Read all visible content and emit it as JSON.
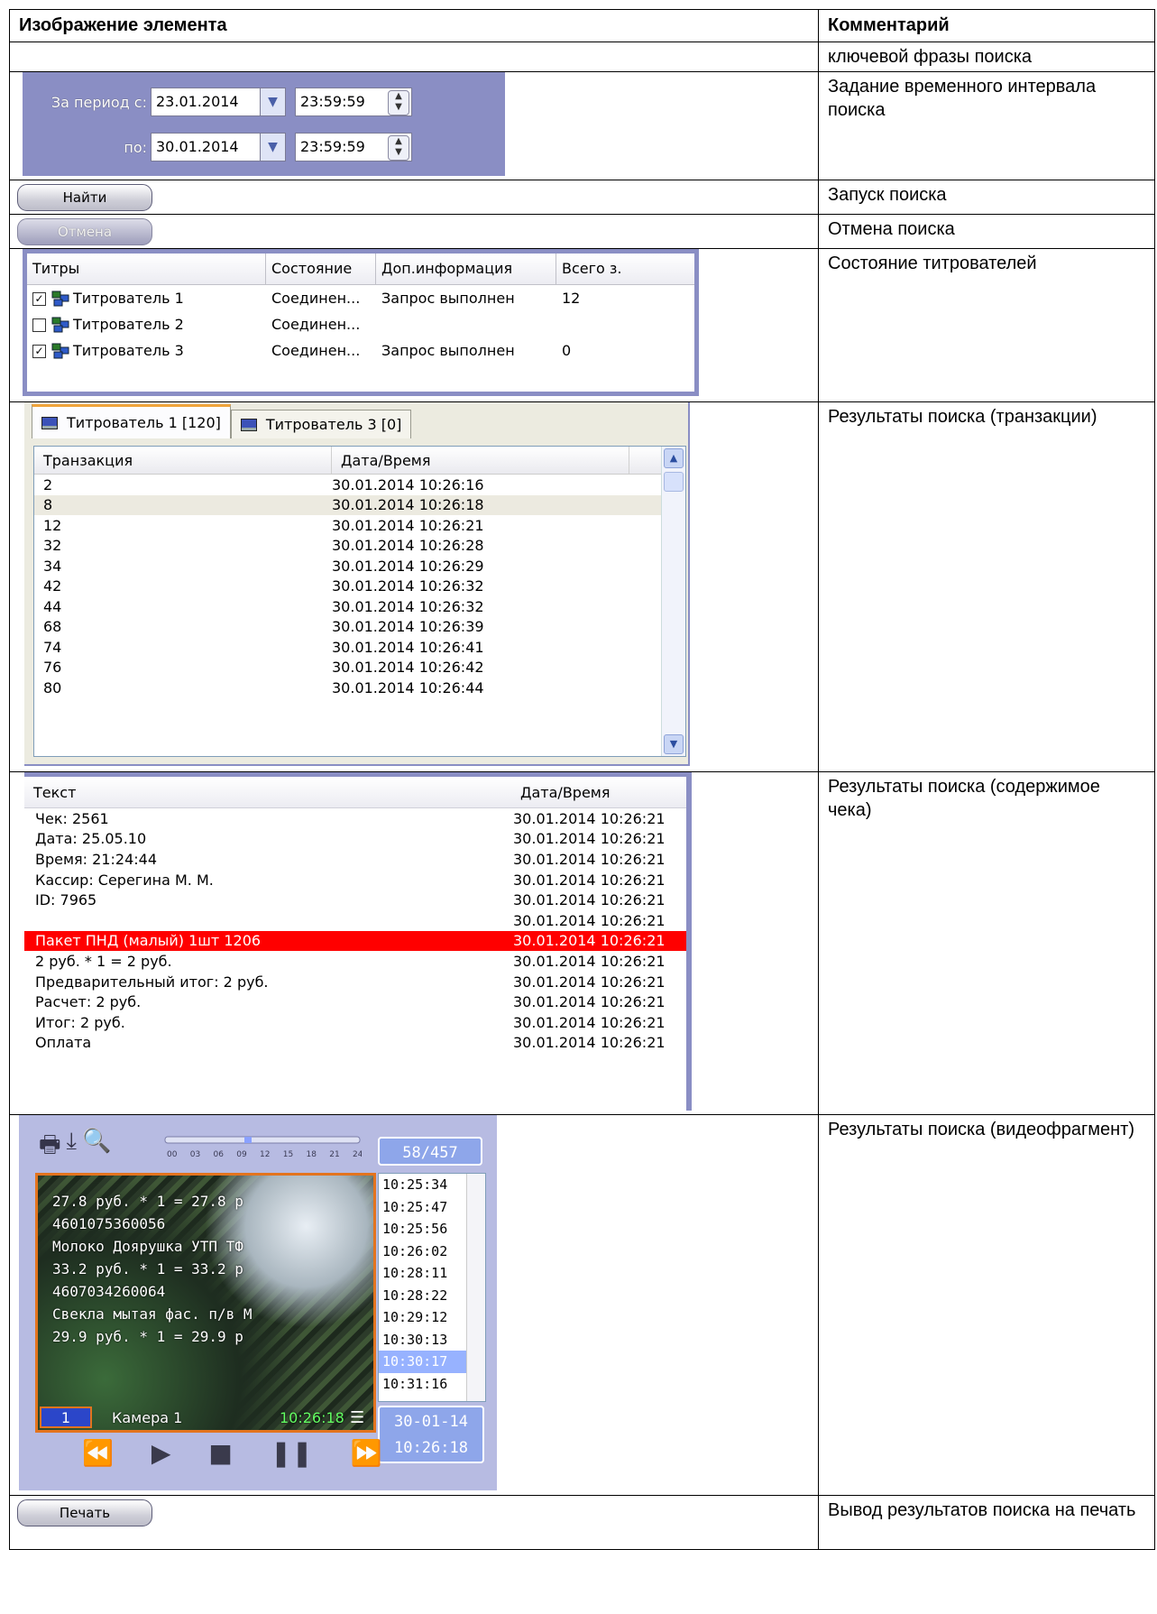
{
  "table": {
    "header_left": "Изображение элемента",
    "header_right": "Комментарий"
  },
  "rows": {
    "r0_comment": "ключевой фразы поиска",
    "r1_comment": "Задание временного интервала поиска",
    "r2_comment": "Запуск поиска",
    "r3_comment": "Отмена поиска",
    "r4_comment": "Состояние титрователей",
    "r5_comment": "Результаты поиска (транзакции)",
    "r6_comment": "Результаты поиска (содержимое чека)",
    "r7_comment": "Результаты поиска (видеофрагмент)",
    "r8_comment": "Вывод результатов поиска на печать"
  },
  "period": {
    "from_label": "За период с:",
    "to_label": "по:",
    "from_date": "23.01.2014",
    "from_time": "23:59:59",
    "to_date": "30.01.2014",
    "to_time": "23:59:59"
  },
  "buttons": {
    "find": "Найти",
    "cancel": "Отмена",
    "print": "Печать"
  },
  "state_table": {
    "headers": [
      "Титры",
      "Состояние",
      "Доп.информация",
      "Всего з."
    ],
    "rows": [
      {
        "checked": true,
        "name": "Титрователь 1",
        "state": "Соединен...",
        "info": "Запрос выполнен",
        "total": "12"
      },
      {
        "checked": false,
        "name": "Титрователь 2",
        "state": "Соединен...",
        "info": "",
        "total": ""
      },
      {
        "checked": true,
        "name": "Титрователь 3",
        "state": "Соединен...",
        "info": "Запрос выполнен",
        "total": "0"
      }
    ]
  },
  "transactions": {
    "tabs": [
      "Титрователь 1 [120]",
      "Титрователь 3 [0]"
    ],
    "headers": [
      "Транзакция",
      "Дата/Время"
    ],
    "rows": [
      [
        "2",
        "30.01.2014 10:26:16"
      ],
      [
        "8",
        "30.01.2014 10:26:18"
      ],
      [
        "12",
        "30.01.2014 10:26:21"
      ],
      [
        "32",
        "30.01.2014 10:26:28"
      ],
      [
        "34",
        "30.01.2014 10:26:29"
      ],
      [
        "42",
        "30.01.2014 10:26:32"
      ],
      [
        "44",
        "30.01.2014 10:26:32"
      ],
      [
        "68",
        "30.01.2014 10:26:39"
      ],
      [
        "74",
        "30.01.2014 10:26:41"
      ],
      [
        "76",
        "30.01.2014 10:26:42"
      ],
      [
        "80",
        "30.01.2014 10:26:44"
      ]
    ],
    "selected_index": 1
  },
  "receipt": {
    "headers": [
      "Текст",
      "Дата/Время"
    ],
    "rows": [
      [
        "Чек: 2561",
        "30.01.2014 10:26:21"
      ],
      [
        "Дата: 25.05.10",
        "30.01.2014 10:26:21"
      ],
      [
        "Время: 21:24:44",
        "30.01.2014 10:26:21"
      ],
      [
        "Кассир: Серегина М. М.",
        "30.01.2014 10:26:21"
      ],
      [
        "ID: 7965",
        "30.01.2014 10:26:21"
      ],
      [
        "",
        "30.01.2014 10:26:21"
      ],
      [
        "Пакет ПНД (малый) 1шт 1206",
        "30.01.2014 10:26:21"
      ],
      [
        " 2 руб. * 1 = 2 руб.",
        "30.01.2014 10:26:21"
      ],
      [
        "Предварительный итог: 2 руб.",
        "30.01.2014 10:26:21"
      ],
      [
        "Расчет: 2 руб.",
        "30.01.2014 10:26:21"
      ],
      [
        "Итог: 2 руб.",
        "30.01.2014 10:26:21"
      ],
      [
        "Оплата",
        "30.01.2014 10:26:21"
      ]
    ],
    "highlight_index": 6,
    "highlight_color": "#ff0000"
  },
  "video": {
    "counter": "58/457",
    "timeline_labels": [
      "00",
      "03",
      "06",
      "09",
      "12",
      "15",
      "18",
      "21",
      "24"
    ],
    "overlay_lines": [
      "27.8 руб. * 1 = 27.8 р",
      "4601075360056",
      "Молоко Доярушка УТП ТФ",
      "33.2 руб. * 1 = 33.2 р",
      "4607034260064",
      "Свекла мытая фас. п/в М",
      "29.9 руб. * 1 = 29.9 р"
    ],
    "camera_number": "1",
    "camera_name": "Камера 1",
    "camera_time": "10:26:18",
    "times": [
      "10:25:34",
      "10:25:47",
      "10:25:56",
      "10:26:02",
      "10:28:11",
      "10:28:22",
      "10:29:12",
      "10:30:13",
      "10:30:17",
      "10:31:16"
    ],
    "selected_time_index": 8,
    "date": "30-01-14",
    "time": "10:26:18",
    "accent_color": "#e3741e"
  }
}
